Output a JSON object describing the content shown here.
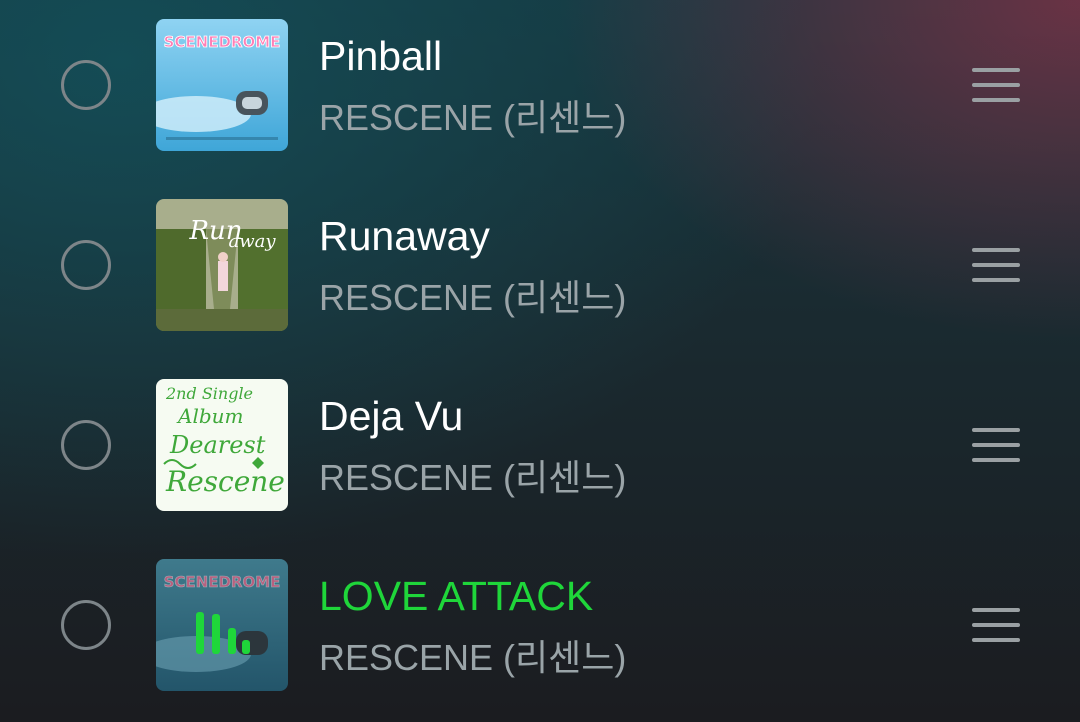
{
  "playlist": {
    "tracks": [
      {
        "title": "Pinball",
        "artist": "RESCENE (리센느)",
        "art_icon": "sceneдrome-album-art",
        "playing": false
      },
      {
        "title": "Runaway",
        "artist": "RESCENE (리센느)",
        "art_icon": "runaway-album-art",
        "playing": false
      },
      {
        "title": "Deja Vu",
        "artist": "RESCENE (리센느)",
        "art_icon": "dearest-album-art",
        "playing": false
      },
      {
        "title": "LOVE ATTACK",
        "artist": "RESCENE (리센느)",
        "art_icon": "scenedrome-album-art",
        "playing": true
      }
    ]
  },
  "colors": {
    "playing_accent": "#1fd63a",
    "title_text": "#ffffff",
    "artist_text": "#9aa4a8"
  }
}
